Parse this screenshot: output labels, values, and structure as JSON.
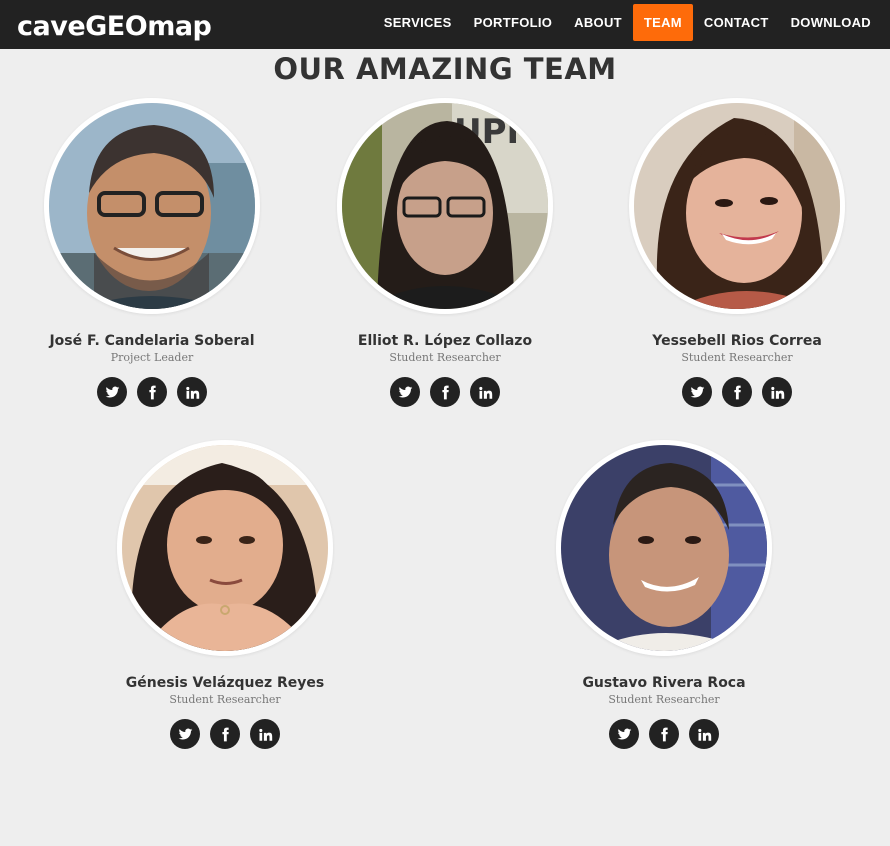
{
  "nav": {
    "brand": "caveGEOmap",
    "items": [
      {
        "label": "SERVICES",
        "active": false
      },
      {
        "label": "PORTFOLIO",
        "active": false
      },
      {
        "label": "ABOUT",
        "active": false
      },
      {
        "label": "TEAM",
        "active": true
      },
      {
        "label": "CONTACT",
        "active": false
      },
      {
        "label": "DOWNLOAD",
        "active": false
      }
    ],
    "active_color": "#fe6b0a"
  },
  "team": {
    "title": "OUR AMAZING TEAM",
    "members": [
      {
        "name": "José F. Candelaria Soberal",
        "role": "Project Leader"
      },
      {
        "name": "Elliot R. López Collazo",
        "role": "Student Researcher"
      },
      {
        "name": "Yessebell Rios Correa",
        "role": "Student Researcher"
      },
      {
        "name": "Génesis Velázquez Reyes",
        "role": "Student Researcher"
      },
      {
        "name": "Gustavo Rivera Roca",
        "role": "Student Researcher"
      }
    ],
    "social_icons": [
      "twitter-icon",
      "facebook-icon",
      "linkedin-icon"
    ]
  }
}
